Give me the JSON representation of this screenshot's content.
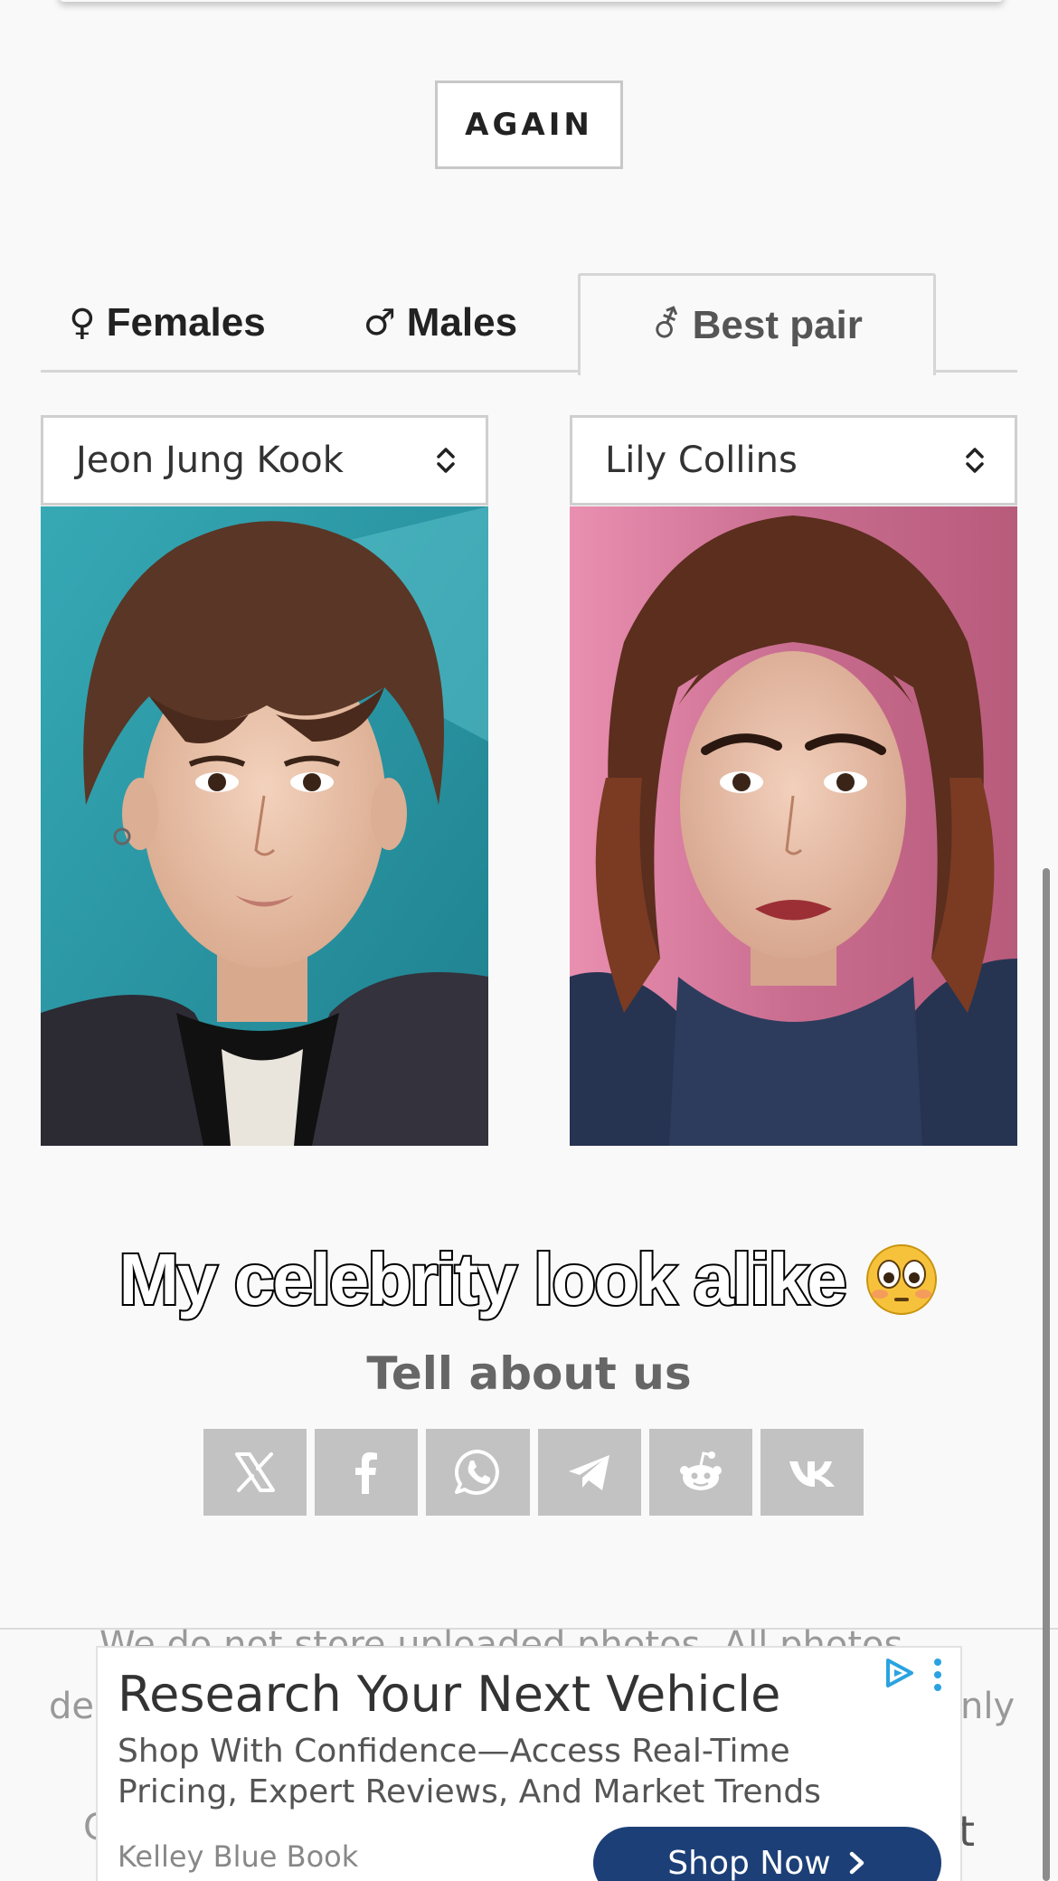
{
  "again_button": {
    "label": "AGAIN"
  },
  "tabs": [
    {
      "symbol": "♀",
      "label": "Females",
      "active": false
    },
    {
      "symbol": "♂",
      "label": "Males",
      "active": false
    },
    {
      "symbol": "⚦",
      "label": "Best pair",
      "active": true
    }
  ],
  "selects": {
    "left": {
      "value": "Jeon Jung Kook"
    },
    "right": {
      "value": "Lily Collins"
    }
  },
  "caption": {
    "text": "My celebrity look alike",
    "emoji": "😳"
  },
  "share": {
    "title": "Tell about us",
    "buttons": [
      {
        "icon": "x-icon"
      },
      {
        "icon": "facebook-icon"
      },
      {
        "icon": "whatsapp-icon"
      },
      {
        "icon": "telegram-icon"
      },
      {
        "icon": "reddit-icon"
      },
      {
        "icon": "vk-icon"
      }
    ]
  },
  "background_text": {
    "line1": "We do not store uploaded photos. All photos",
    "line2_left": "de",
    "line2_right": "nly",
    "line3_left": "C",
    "line3_right": "t"
  },
  "ad": {
    "title": "Research Your Next Vehicle",
    "description": "Shop With Confidence—Access Real-Time Pricing, Expert Reviews, And Market Trends",
    "brand": "Kelley Blue Book",
    "cta": "Shop Now",
    "colors": {
      "cta_bg": "#1c3f77",
      "adchoices": "#2aa3e0"
    }
  }
}
